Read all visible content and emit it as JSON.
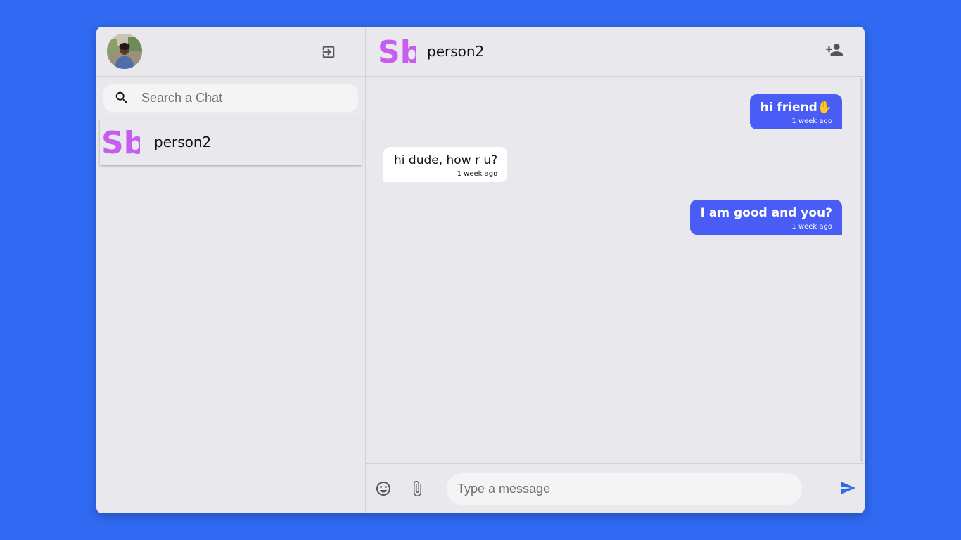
{
  "sidebar": {
    "search": {
      "placeholder": "Search a Chat",
      "value": ""
    },
    "chats": [
      {
        "name": "person2",
        "logo_text": "Sb"
      }
    ]
  },
  "main": {
    "header": {
      "name": "person2",
      "logo_text": "Sb"
    },
    "messages": [
      {
        "direction": "sent",
        "text": "hi friend✋",
        "time": "1 week ago"
      },
      {
        "direction": "recv",
        "text": "hi dude, how r u?",
        "time": "1 week ago"
      },
      {
        "direction": "sent",
        "text": "I am good and you?",
        "time": "1 week ago"
      }
    ],
    "composer": {
      "placeholder": "Type a message",
      "value": ""
    }
  },
  "colors": {
    "background": "#306af2",
    "panel": "#e9e8ed",
    "sent_bubble": "#4a5cf6",
    "received_bubble": "#ffffff",
    "logo": "#c75cf0",
    "send_icon": "#2f6be8"
  },
  "icons": {
    "search": "search-icon",
    "logout": "logout-icon",
    "add_user": "person-add-icon",
    "emoji": "emoji-icon",
    "attach": "paperclip-icon",
    "send": "send-icon"
  }
}
